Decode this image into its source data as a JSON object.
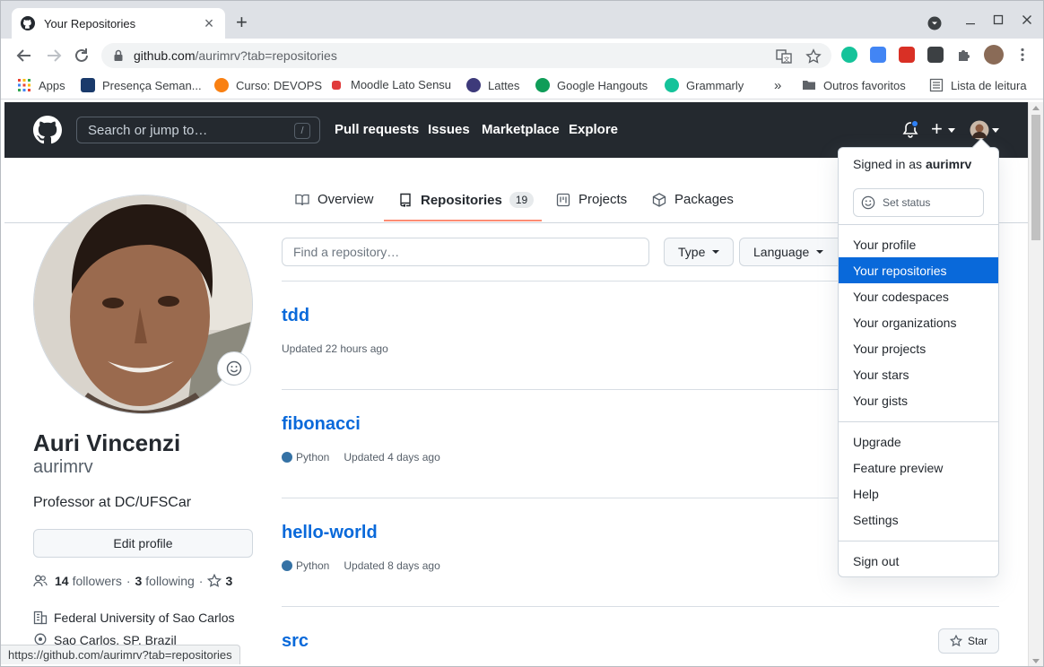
{
  "browser": {
    "tab_title": "Your Repositories",
    "new_tab": "+",
    "url_host": "github.com",
    "url_path": "/aurimrv?tab=repositories",
    "status_url": "https://github.com/aurimrv?tab=repositories",
    "bookmarks": [
      {
        "label": "Apps",
        "icon": "apps-grid-icon",
        "color": "#ea4335"
      },
      {
        "label": "Presença Seman...",
        "icon": "presenca-icon",
        "color": "#1a3a6b"
      },
      {
        "label": "Curso: DEVOPS",
        "icon": "moodle-icon",
        "color": "#f98012"
      },
      {
        "label": "Moodle Lato Sensu",
        "icon": "moodle-hat-icon",
        "color": "#e03b3b"
      },
      {
        "label": "Lattes",
        "icon": "lattes-icon",
        "color": "#3d3a7a"
      },
      {
        "label": "Google Hangouts",
        "icon": "hangouts-icon",
        "color": "#0f9d58"
      },
      {
        "label": "Grammarly",
        "icon": "grammarly-icon",
        "color": "#15c39a"
      }
    ],
    "bookmarks_more": "»",
    "other_bookmarks": "Outros favoritos",
    "reading_list": "Lista de leitura"
  },
  "github": {
    "search_placeholder": "Search or jump to…",
    "search_key": "/",
    "nav": [
      "Pull requests",
      "Issues",
      "Marketplace",
      "Explore"
    ],
    "plus": "+"
  },
  "tabs": {
    "overview": "Overview",
    "repositories": "Repositories",
    "repositories_count": "19",
    "projects": "Projects",
    "packages": "Packages"
  },
  "profile": {
    "name": "Auri Vincenzi",
    "login": "aurimrv",
    "bio": "Professor at DC/UFSCar",
    "edit_label": "Edit profile",
    "followers_count": "14",
    "followers_label": "followers",
    "separator": "·",
    "following_count": "3",
    "following_label": "following",
    "stars_count": "3",
    "organization": "Federal University of Sao Carlos",
    "location": "Sao Carlos, SP, Brazil"
  },
  "filters": {
    "find_placeholder": "Find a repository…",
    "type": "Type",
    "language": "Language"
  },
  "repos": [
    {
      "name": "tdd",
      "language": "",
      "updated": "Updated 22 hours ago"
    },
    {
      "name": "fibonacci",
      "language": "Python",
      "updated": "Updated 4 days ago"
    },
    {
      "name": "hello-world",
      "language": "Python",
      "updated": "Updated 8 days ago"
    },
    {
      "name": "src",
      "language": "",
      "updated": ""
    }
  ],
  "star_label": "Star",
  "language_color": "#3572a5",
  "dropdown": {
    "signed_in_prefix": "Signed in as",
    "username": "aurimrv",
    "set_status": "Set status",
    "items_1": [
      "Your profile",
      "Your repositories",
      "Your codespaces",
      "Your organizations",
      "Your projects",
      "Your stars",
      "Your gists"
    ],
    "items_2": [
      "Upgrade",
      "Feature preview",
      "Help",
      "Settings"
    ],
    "sign_out": "Sign out",
    "selected": "Your repositories",
    "selected_color": "#0969da"
  }
}
